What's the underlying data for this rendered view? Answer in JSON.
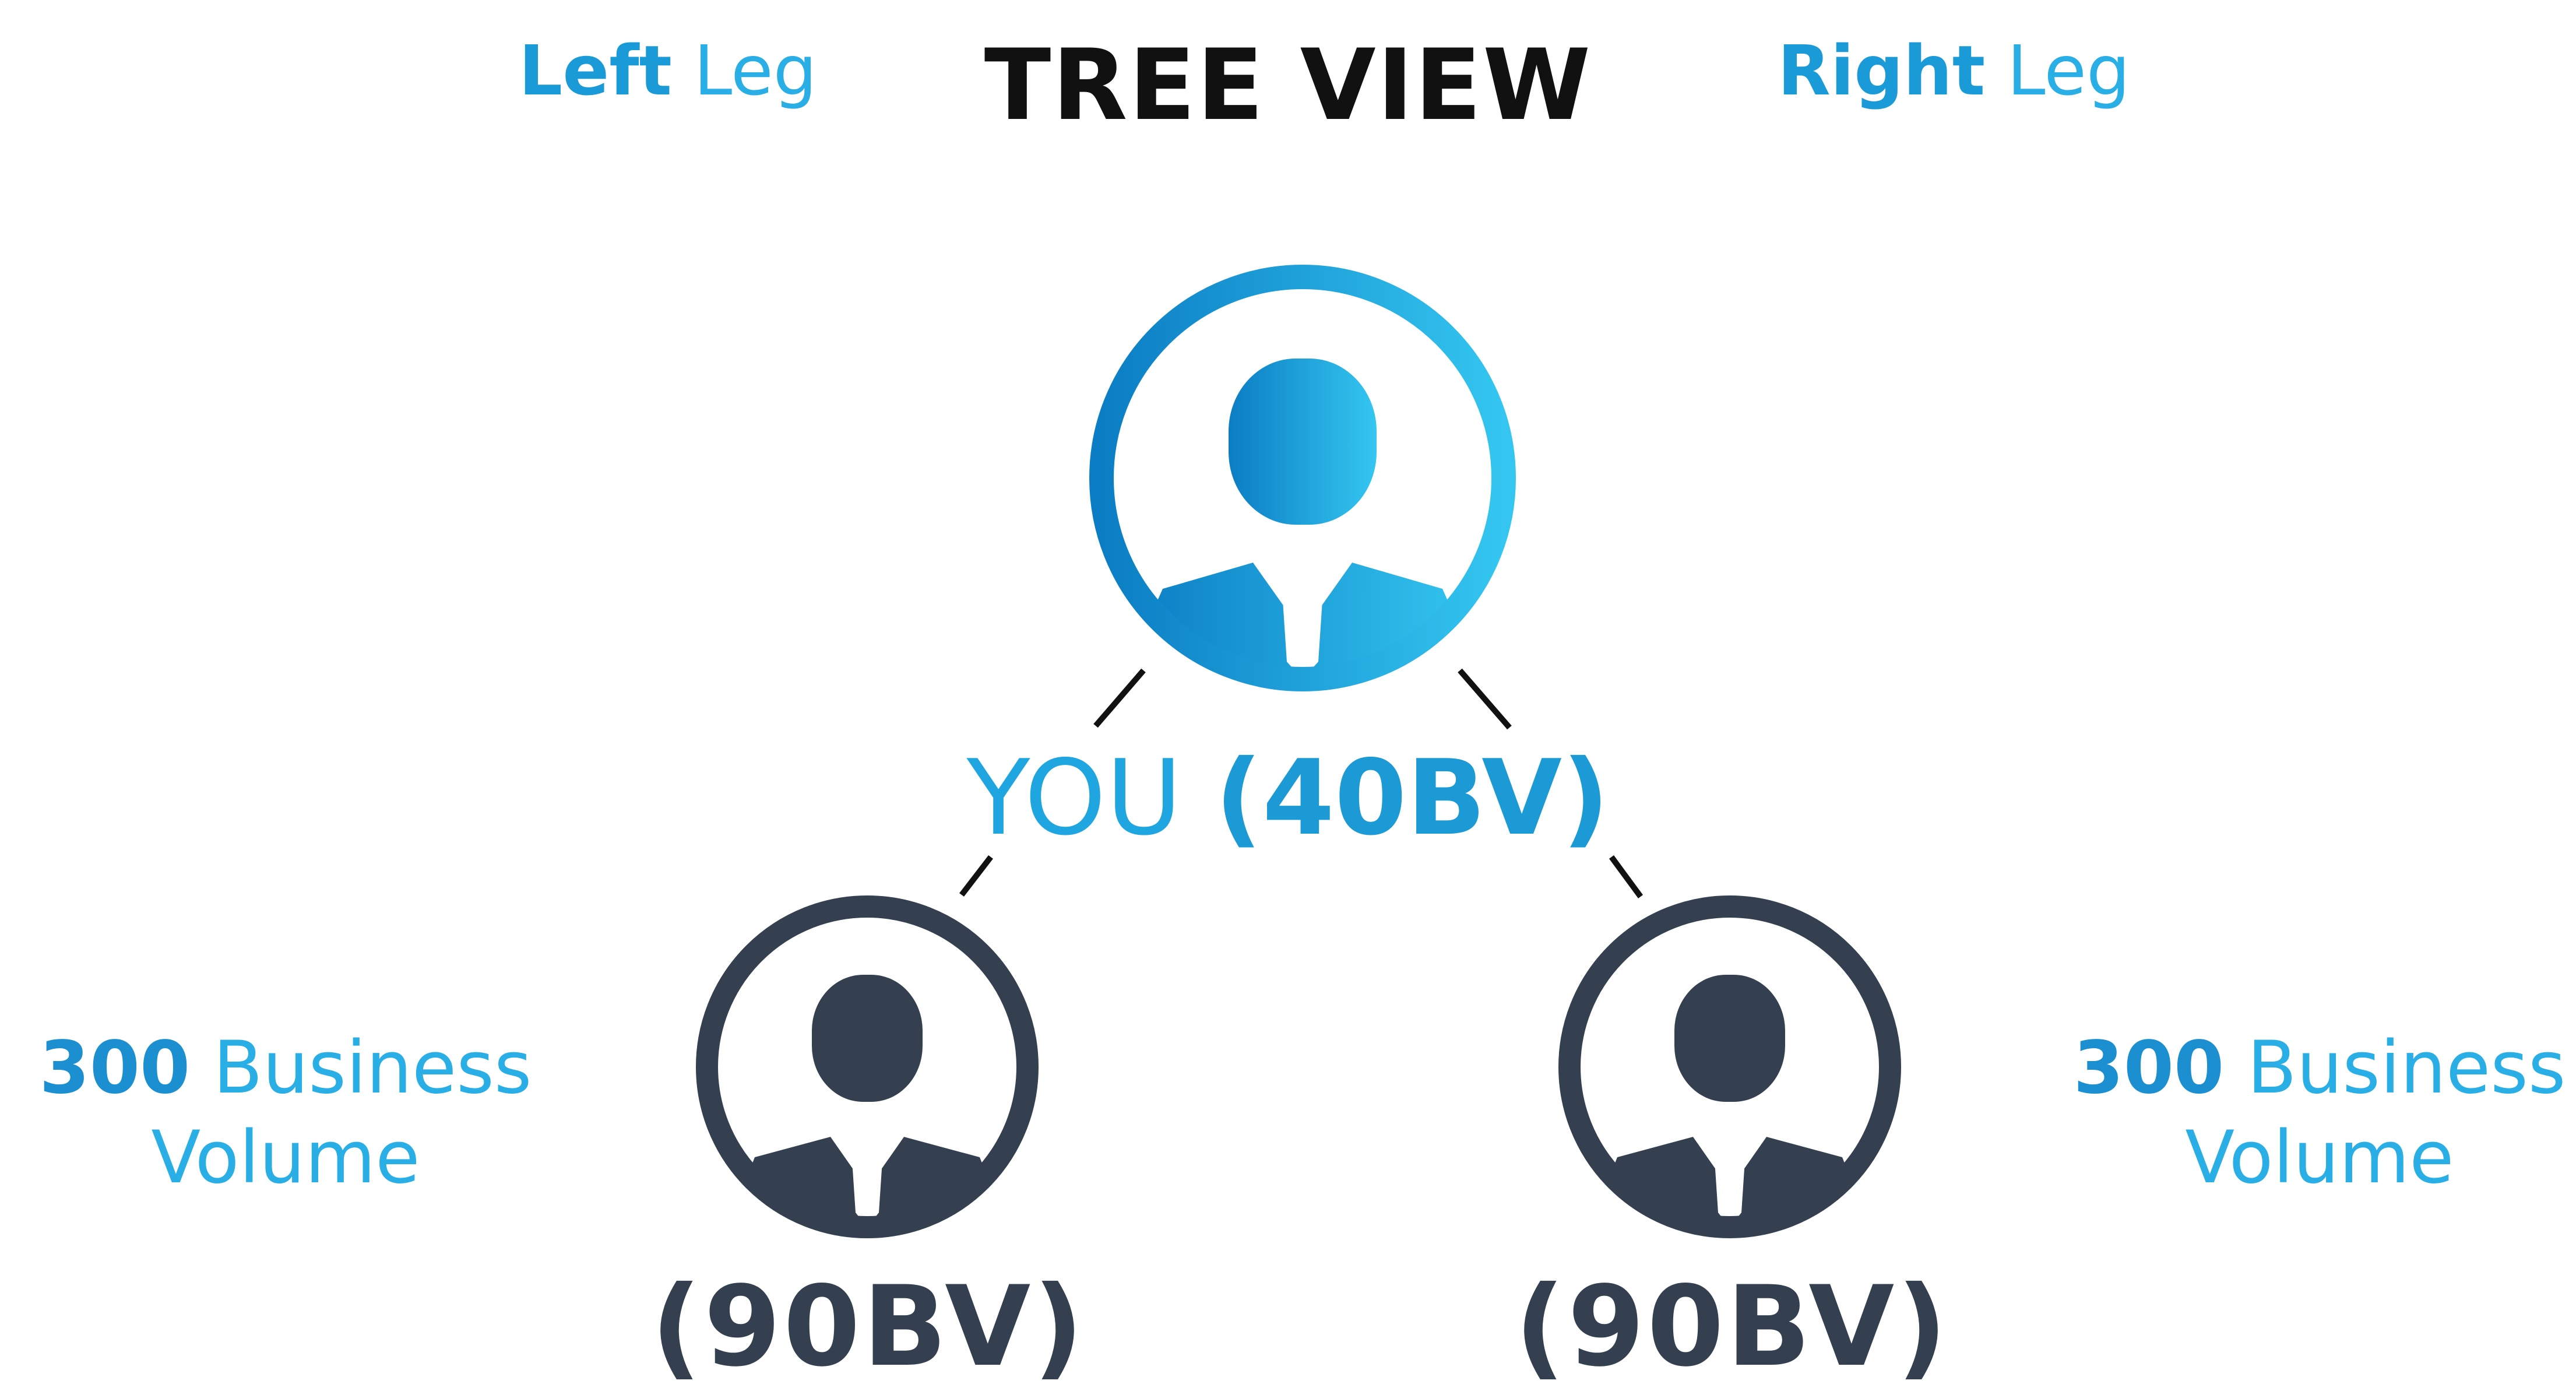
{
  "header": {
    "left_leg": {
      "strong": "Left",
      "light": "Leg"
    },
    "title": "TREE VIEW",
    "right_leg": {
      "strong": "Right",
      "light": "Leg"
    }
  },
  "root": {
    "name": "YOU",
    "bv": "(40BV)"
  },
  "children": [
    {
      "bv": "(90BV)"
    },
    {
      "bv": "(90BV)"
    }
  ],
  "left_volume": {
    "amount": "300",
    "line1": "Business",
    "line2": "Volume"
  },
  "right_volume": {
    "amount": "300",
    "line1": "Business",
    "line2": "Volume"
  },
  "colors": {
    "brand_blue": "#1b9ad8",
    "brand_blue_light": "#34c6f0",
    "brand_blue_dark": "#0b7dc4",
    "dark_user": "#34404f",
    "title": "#111111"
  },
  "icons": [
    "user-avatar-icon",
    "user-avatar-icon",
    "user-avatar-icon"
  ]
}
